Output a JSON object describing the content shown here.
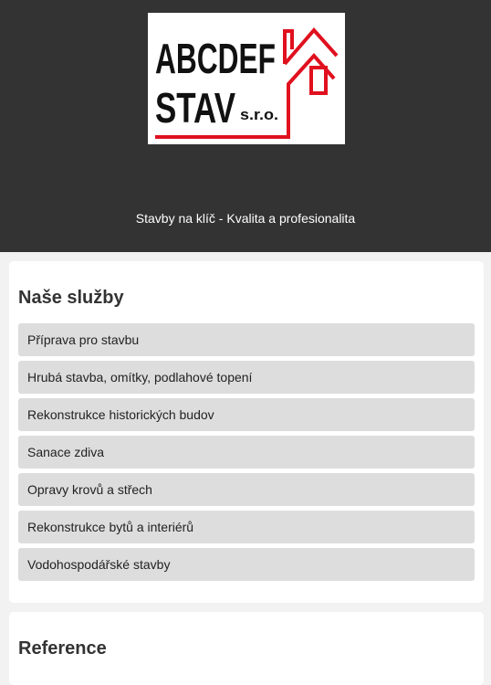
{
  "header": {
    "logo": {
      "line1": "ABCDEF",
      "line2": "STAV",
      "suffix": "s.r.o.",
      "accent_color": "#e0101e"
    },
    "tagline": "Stavby na klíč - Kvalita a profesionalita",
    "background_color": "#333333"
  },
  "services": {
    "title": "Naše služby",
    "items": [
      "Příprava pro stavbu",
      "Hrubá stavba, omítky, podlahové topení",
      "Rekonstrukce historických budov",
      "Sanace zdiva",
      "Opravy krovů a střech",
      "Rekonstrukce bytů a interiérů",
      "Vodohospodářské stavby"
    ]
  },
  "reference": {
    "title": "Reference"
  }
}
